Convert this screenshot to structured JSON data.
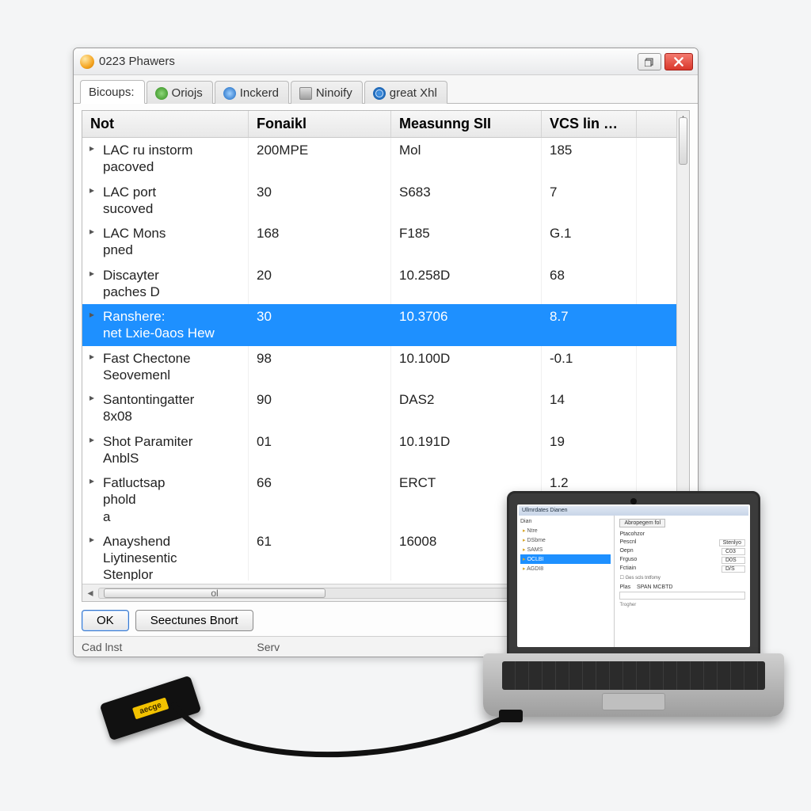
{
  "window": {
    "title": "0223 Phawers",
    "tabs": [
      {
        "label": "Bicoups:",
        "icon": "none",
        "active": true
      },
      {
        "label": "Oriojs",
        "icon": "green",
        "active": false
      },
      {
        "label": "Inckerd",
        "icon": "blue",
        "active": false
      },
      {
        "label": "Ninoify",
        "icon": "grey",
        "active": false
      },
      {
        "label": "great Xhl",
        "icon": "globe",
        "active": false
      }
    ],
    "columns": [
      "Not",
      "Fonaikl",
      "Measunng SII",
      "VCS lin Cunce"
    ],
    "rows": [
      {
        "c0": "LAC ru instorm\npacoved",
        "c1": "200MPE",
        "c2": "Mol",
        "c3": "185",
        "selected": false
      },
      {
        "c0": "LAC port\nsucoved",
        "c1": "30",
        "c2": "S683",
        "c3": "7",
        "selected": false
      },
      {
        "c0": "LAC Mons\npned",
        "c1": "168",
        "c2": "F185",
        "c3": "G.1",
        "selected": false
      },
      {
        "c0": "Discayter\npaches D",
        "c1": "20",
        "c2": "10.258D",
        "c3": "68",
        "selected": false
      },
      {
        "c0": "Ranshere:\nnet Lxie-0aos Hew",
        "c1": "30",
        "c2": "10.3706",
        "c3": "8.7",
        "selected": true
      },
      {
        "c0": "Fast Chectone\nSeovemenl",
        "c1": "98",
        "c2": "10.100D",
        "c3": "-0.1",
        "selected": false
      },
      {
        "c0": "Santontingatter\n8x08",
        "c1": "90",
        "c2": "DAS2",
        "c3": "14",
        "selected": false
      },
      {
        "c0": "Shot Paramiter\nAnblS",
        "c1": "01",
        "c2": "10.191D",
        "c3": "19",
        "selected": false
      },
      {
        "c0": "Fatluctsap\nphold\na",
        "c1": "66",
        "c2": "ERCT",
        "c3": "1.2",
        "selected": false
      },
      {
        "c0": "Anayshend\nLiytinesentic\nStenplor",
        "c1": "61",
        "c2": "16008",
        "c3": "",
        "selected": false
      }
    ],
    "hscroll_label": "ol",
    "footer_buttons": {
      "ok": "OK",
      "secondary": "Seectunes Bnort"
    },
    "status": {
      "left": "Cad lnst",
      "right": "Serv"
    }
  },
  "laptop": {
    "titlebar": "Ullmrdates Dianen",
    "left_header": "Dian",
    "left_items": [
      {
        "label": "Ntre",
        "sel": false
      },
      {
        "label": "DSbme",
        "sel": false
      },
      {
        "label": "SAMS",
        "sel": false
      },
      {
        "label": "OCLBI",
        "sel": true
      },
      {
        "label": "AGDI8",
        "sel": false
      }
    ],
    "right_tab": "Abropegem fol",
    "right_header": "Ptacohzor",
    "fields": [
      {
        "k": "Pescnl",
        "v": "Stenlyo"
      },
      {
        "k": "Oepn",
        "v": "C03"
      },
      {
        "k": "Frguso",
        "v": "D0S"
      },
      {
        "k": "Fctiain",
        "v": "D/S"
      }
    ],
    "checkbox": "Ges scls tntfomy",
    "big_label": "Plas",
    "big_value": "SPAN MCBTD",
    "footer_label": "Trogher"
  },
  "dongle_label": "aecge"
}
